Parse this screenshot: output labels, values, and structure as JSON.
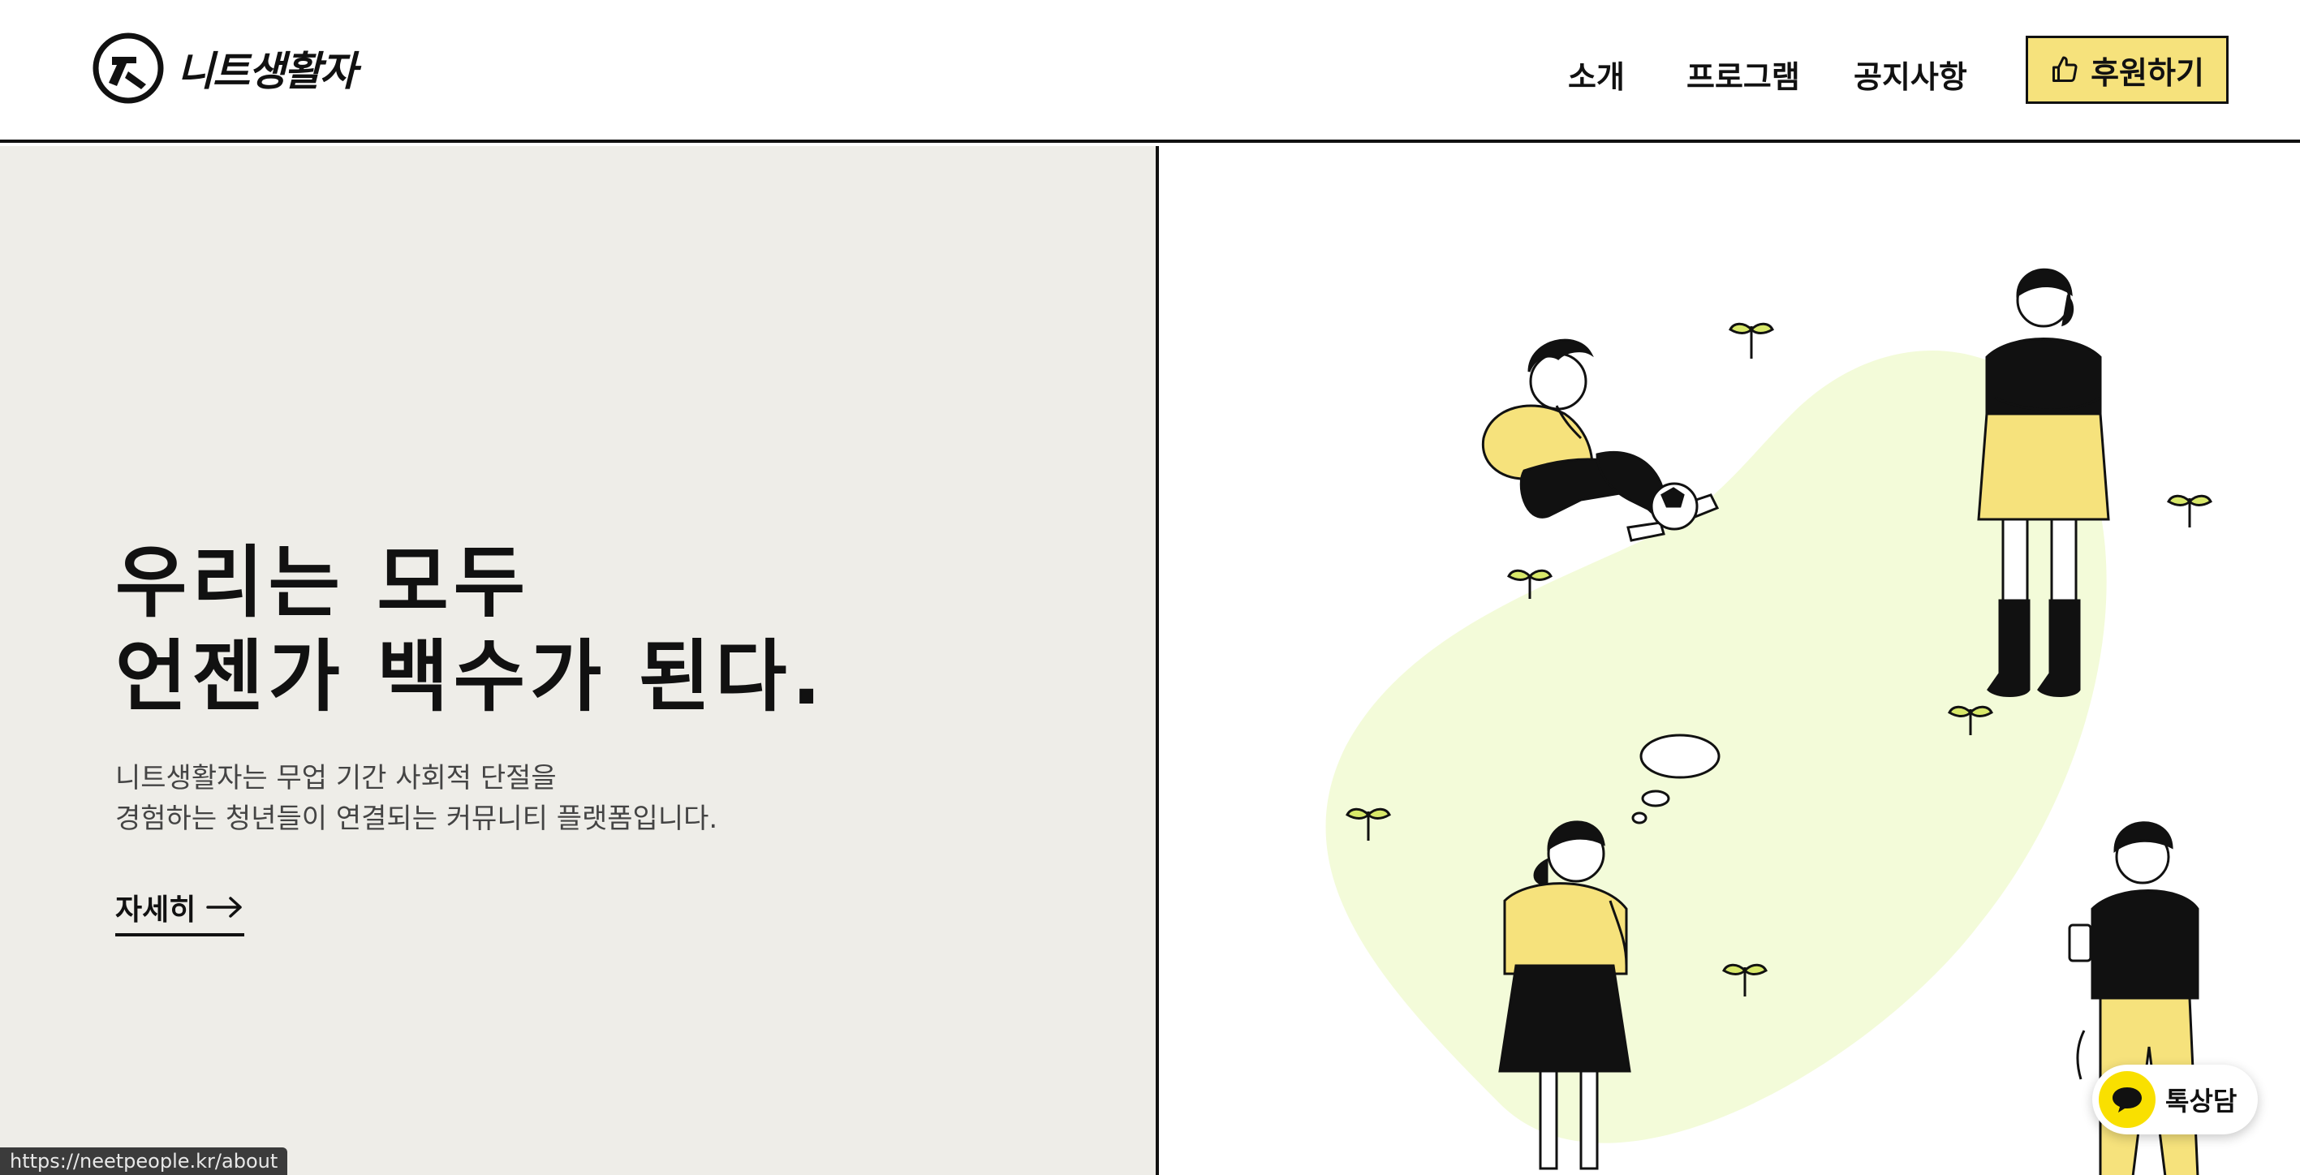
{
  "header": {
    "logo_text": "니트생활자",
    "nav": [
      "소개",
      "프로그램",
      "공지사항"
    ],
    "donate_label": "후원하기"
  },
  "hero": {
    "headline_line1": "우리는 모두",
    "headline_line2": "언젠가 백수가 된다.",
    "desc_line1": "니트생활자는 무업 기간 사회적 단절을",
    "desc_line2": "경험하는 청년들이 연결되는 커뮤니티 플랫폼입니다.",
    "more_label": "자세히"
  },
  "status_bar": {
    "url": "https://neetpeople.kr/about"
  },
  "chat_widget": {
    "label": "톡상담"
  },
  "colors": {
    "accent_yellow": "#f6e27c",
    "left_panel_bg": "#eeede8",
    "blob_green": "#f3fbd9",
    "kakao_yellow": "#f9e000"
  }
}
